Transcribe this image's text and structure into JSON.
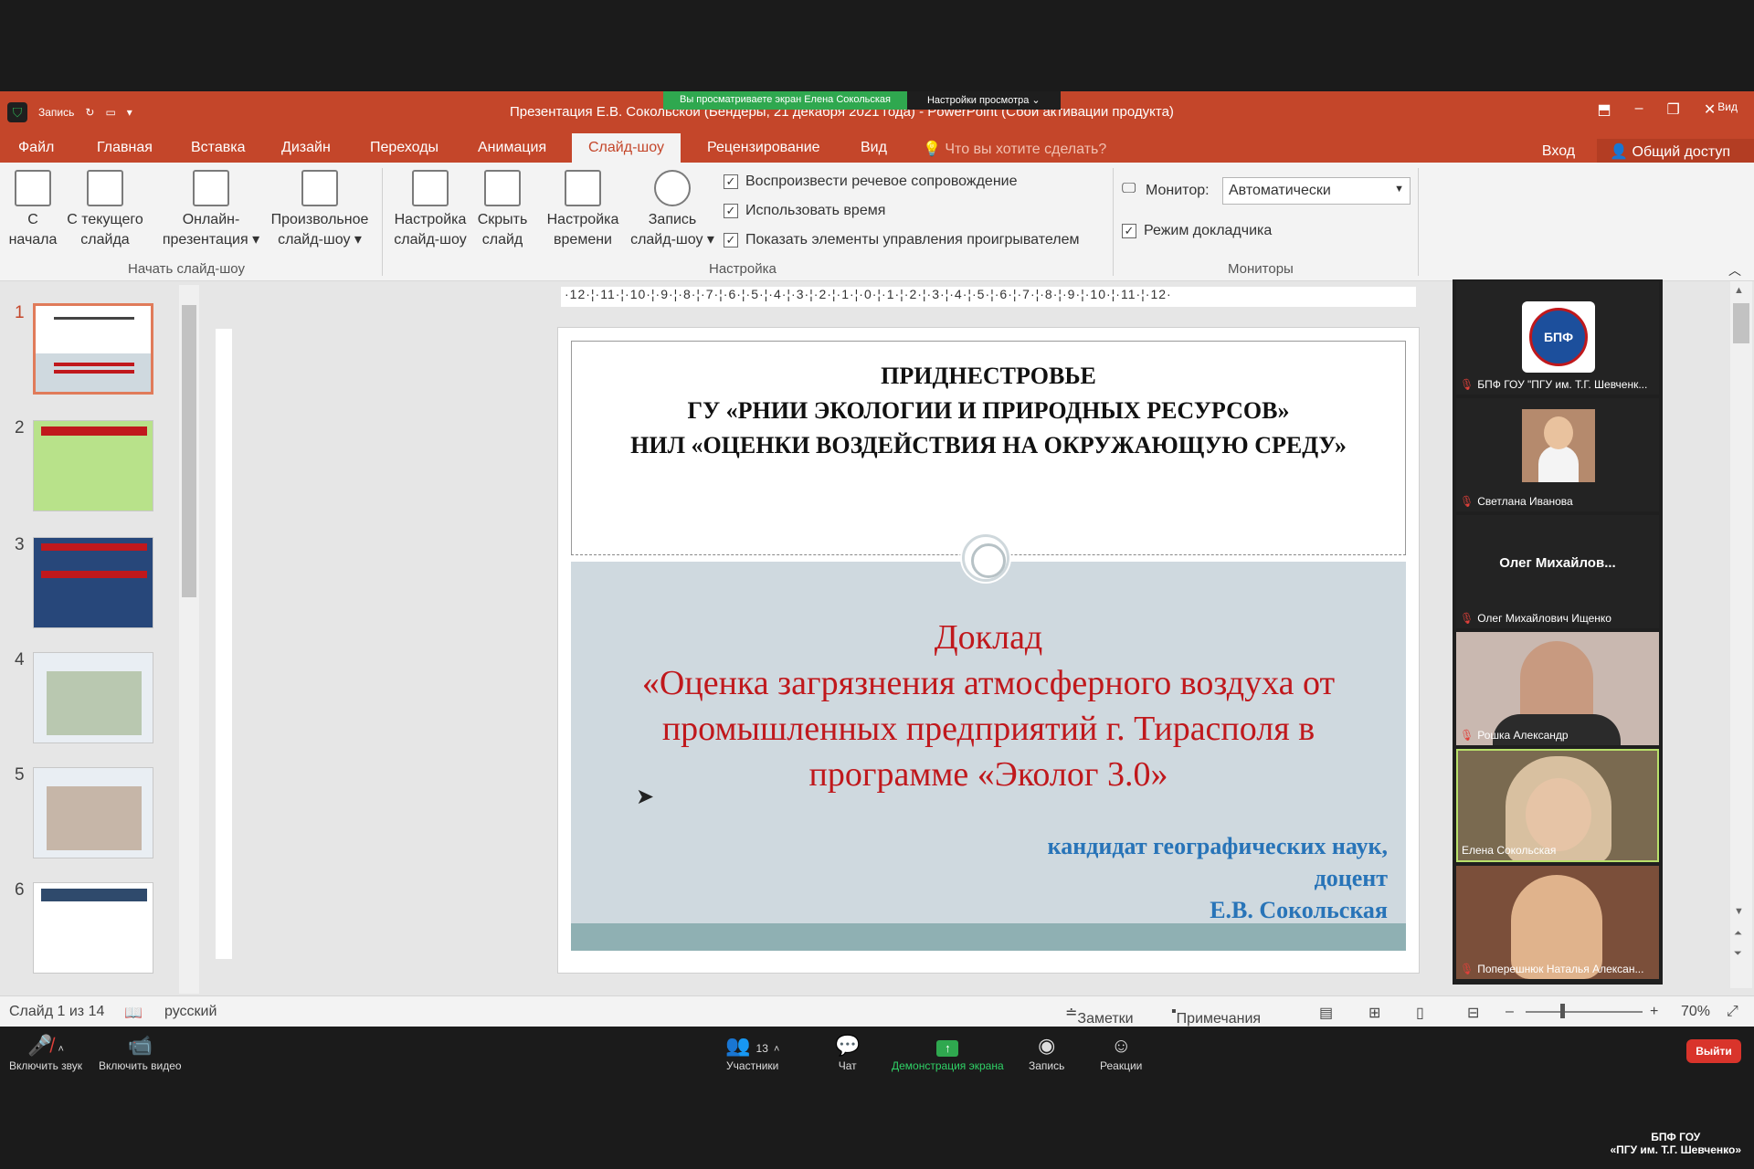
{
  "zoom_share": {
    "viewing_label": "Вы просматриваете экран Елена Сокольская",
    "view_options_label": "Настройки просмотра ⌄"
  },
  "ppt": {
    "title": "Презентация Е.В. Сокольской (Бендеры, 21 декабря 2021 года) - PowerPoint (Сбой активации продукта)",
    "record_label": "Запись",
    "vid_label": "Вид",
    "tabs": [
      "Файл",
      "Главная",
      "Вставка",
      "Дизайн",
      "Переходы",
      "Анимация",
      "Слайд-шоу",
      "Рецензирование",
      "Вид"
    ],
    "active_tab": "Слайд-шоу",
    "search_hint": "Что вы хотите сделать?",
    "signin": "Вход",
    "share": "Общий доступ"
  },
  "ribbon": {
    "from_start": [
      "С",
      "начала"
    ],
    "from_current": [
      "С текущего",
      "слайда"
    ],
    "online": [
      "Онлайн-",
      "презентация ▾"
    ],
    "custom": [
      "Произвольное",
      "слайд-шоу ▾"
    ],
    "group_start": "Начать слайд-шоу",
    "setup": [
      "Настройка",
      "слайд-шоу"
    ],
    "hide": [
      "Скрыть",
      "слайд"
    ],
    "rehearse": [
      "Настройка",
      "времени"
    ],
    "record": [
      "Запись",
      "слайд-шоу ▾"
    ],
    "chk_narration": "Воспроизвести речевое сопровождение",
    "chk_timings": "Использовать время",
    "chk_controls": "Показать элементы управления проигрывателем",
    "group_setup": "Настройка",
    "monitor_label": "Монитор:",
    "monitor_value": "Автоматически",
    "presenter_view": "Режим докладчика",
    "group_monitors": "Мониторы"
  },
  "thumbnails": [
    "1",
    "2",
    "3",
    "4",
    "5",
    "6"
  ],
  "ruler_text": "·12·¦·11·¦·10·¦·9·¦·8·¦·7·¦·6·¦·5·¦·4·¦·3·¦·2·¦·1·¦·0·¦·1·¦·2·¦·3·¦·4·¦·5·¦·6·¦·7·¦·8·¦·9·¦·10·¦·11·¦·12·",
  "slide": {
    "heading_lines": [
      "ПРИДНЕСТРОВЬЕ",
      "ГУ «РНИИ ЭКОЛОГИИ И ПРИРОДНЫХ РЕСУРСОВ»",
      "НИЛ «ОЦЕНКИ ВОЗДЕЙСТВИЯ НА ОКРУЖАЮЩУЮ СРЕДУ»"
    ],
    "doklad_lines": [
      "Доклад",
      "«Оценка загрязнения атмосферного воздуха от",
      "промышленных предприятий г. Тирасполя в",
      "программе «Эколог 3.0»"
    ],
    "author_lines": [
      "кандидат географических наук,",
      "доцент",
      "Е.В. Сокольская"
    ]
  },
  "participants": [
    {
      "name": "БПФ ГОУ \"ПГУ им. Т.Г. Шевченк..."
    },
    {
      "name": "Светлана Иванова"
    },
    {
      "name": "Олег Михайлович Ищенко",
      "center": "Олег  Михайлов..."
    },
    {
      "name": "Рошка Александр"
    },
    {
      "name": "Елена Сокольская"
    },
    {
      "name": "Поперешнюк Наталья Алексан..."
    }
  ],
  "statusbar": {
    "slide_count": "Слайд 1 из 14",
    "language": "русский",
    "notes": "Заметки",
    "comments": "Примечания",
    "zoom": "70%"
  },
  "zoom_toolbar": {
    "unmute": "Включить звук",
    "start_video": "Включить видео",
    "participants_count": "13",
    "participants": "Участники",
    "chat": "Чат",
    "share_screen": "Демонстрация экрана",
    "record": "Запись",
    "reactions": "Реакции",
    "leave": "Выйти"
  },
  "corner_tag": [
    "БПФ ГОУ",
    "«ПГУ им. Т.Г. Шевченко»"
  ],
  "colors": {
    "ppt_accent": "#c4462a",
    "slide_red": "#c0181c",
    "slide_blue": "#2874b8",
    "zoom_green": "#2fa84f"
  }
}
